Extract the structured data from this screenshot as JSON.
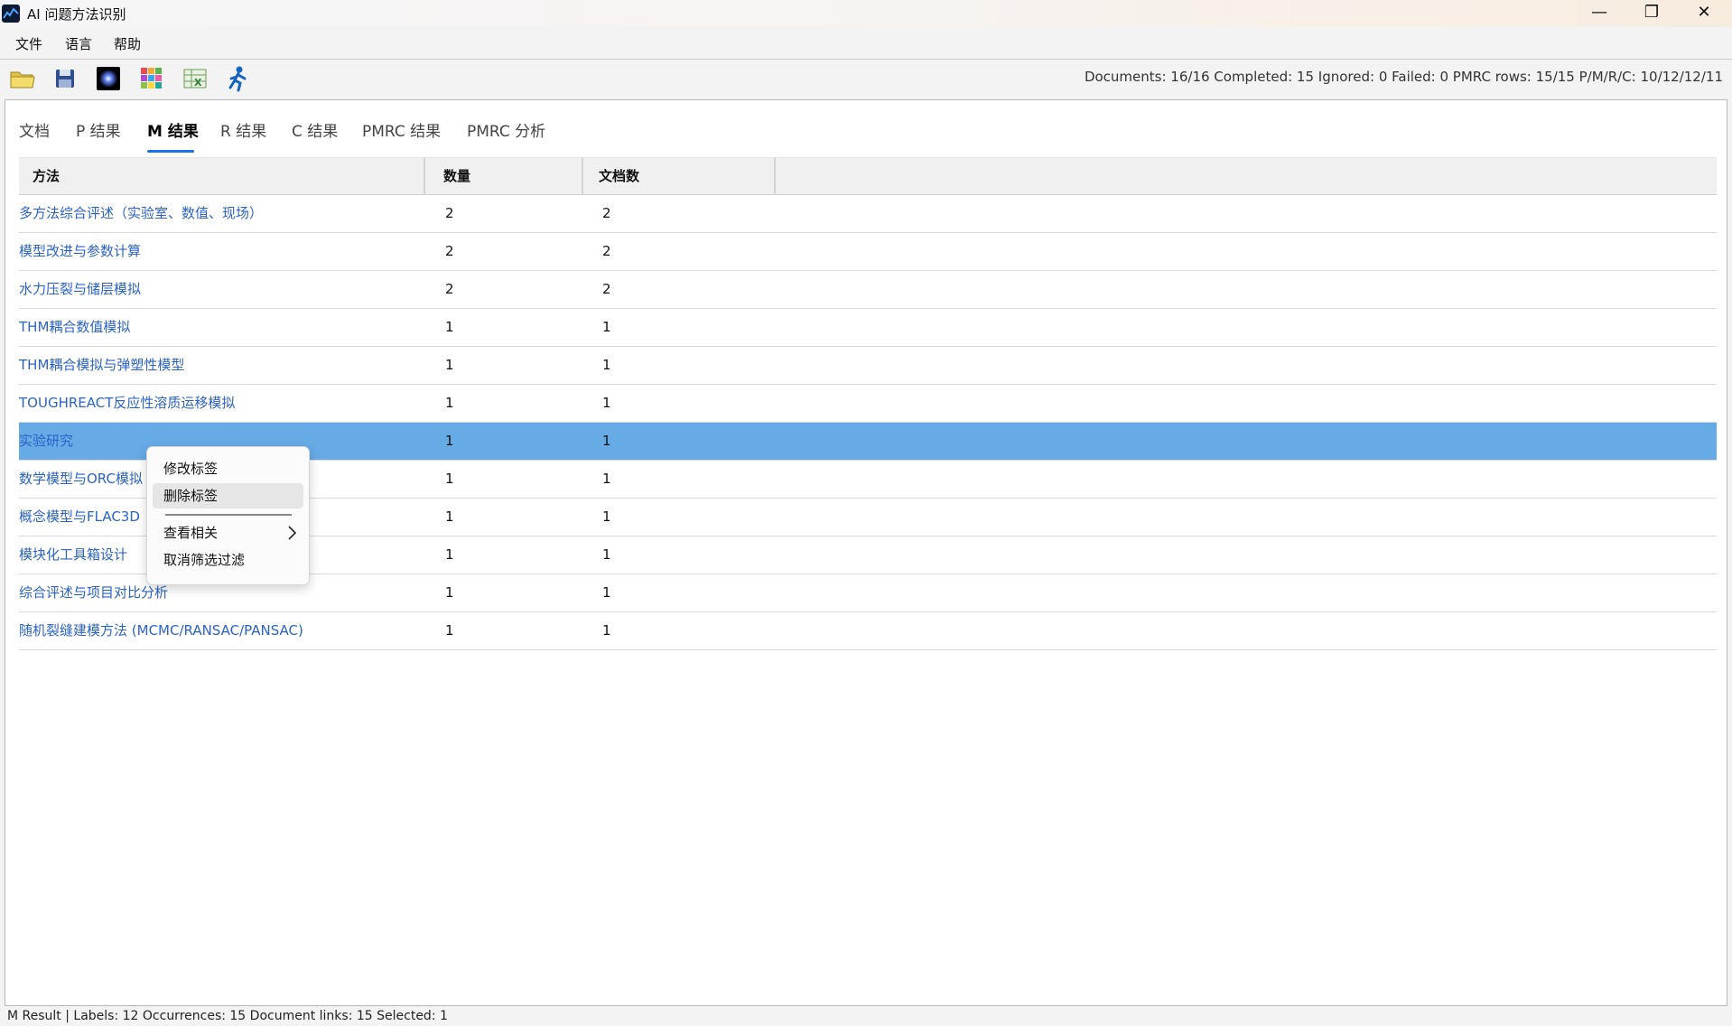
{
  "window": {
    "title": "AI 问题方法识别",
    "minimize": "—",
    "maximize": "❐",
    "close": "✕"
  },
  "menu": {
    "items": [
      "文件",
      "语言",
      "帮助"
    ]
  },
  "toolbar": {
    "icons": [
      "open-folder-icon",
      "save-icon",
      "dark-sphere-icon",
      "color-grid-icon",
      "excel-export-icon",
      "runner-icon"
    ],
    "stats": "Documents: 16/16  Completed: 15  Ignored: 0  Failed: 0  PMRC rows: 15/15  P/M/R/C: 10/12/12/11"
  },
  "tabs": [
    {
      "label": "文档"
    },
    {
      "label": "P 结果"
    },
    {
      "label": "M 结果",
      "active": true
    },
    {
      "label": "R 结果"
    },
    {
      "label": "C 结果"
    },
    {
      "label": "PMRC 结果"
    },
    {
      "label": "PMRC 分析"
    }
  ],
  "table": {
    "columns": [
      "方法",
      "数量",
      "文档数"
    ],
    "rows": [
      {
        "method": "多方法综合评述（实验室、数值、现场）",
        "count": "2",
        "docs": "2"
      },
      {
        "method": "模型改进与参数计算",
        "count": "2",
        "docs": "2"
      },
      {
        "method": "水力压裂与储层模拟",
        "count": "2",
        "docs": "2"
      },
      {
        "method": "THM耦合数值模拟",
        "count": "1",
        "docs": "1"
      },
      {
        "method": "THM耦合模拟与弹塑性模型",
        "count": "1",
        "docs": "1"
      },
      {
        "method": "TOUGHREACT反应性溶质运移模拟",
        "count": "1",
        "docs": "1"
      },
      {
        "method": "实验研究",
        "count": "1",
        "docs": "1",
        "selected": true
      },
      {
        "method": "数学模型与ORC模拟",
        "count": "1",
        "docs": "1"
      },
      {
        "method": "概念模型与FLAC3D",
        "count": "1",
        "docs": "1"
      },
      {
        "method": "模块化工具箱设计",
        "count": "1",
        "docs": "1"
      },
      {
        "method": "综合评述与项目对比分析",
        "count": "1",
        "docs": "1"
      },
      {
        "method": "随机裂缝建模方法 (MCMC/RANSAC/PANSAC)",
        "count": "1",
        "docs": "1"
      }
    ]
  },
  "context_menu": {
    "edit_label": "修改标签",
    "delete_label": "删除标签",
    "view_related": "查看相关",
    "clear_filter": "取消筛选过滤"
  },
  "status": "M Result | Labels: 12  Occurrences: 15  Document links: 15  Selected: 1"
}
